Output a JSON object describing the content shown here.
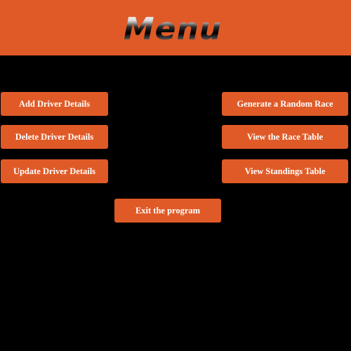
{
  "header": {
    "title": "Menu"
  },
  "buttons": {
    "add_driver": "Add Driver Details",
    "delete_driver": "Delete Driver Details",
    "update_driver": "Update Driver Details",
    "generate_race": "Generate a Random Race",
    "view_race_table": "View the Race Table",
    "view_standings": "View Standings Table",
    "exit": "Exit the program"
  },
  "colors": {
    "accent": "#e05a27",
    "background": "#000000",
    "button_text": "#ffffff"
  }
}
